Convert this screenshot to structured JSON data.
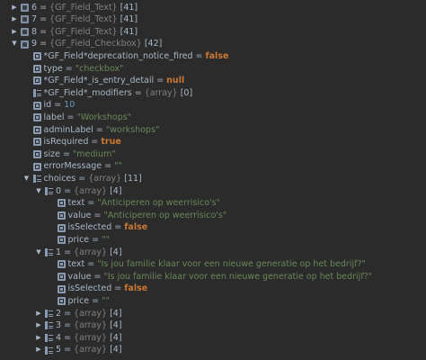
{
  "rows": [
    {
      "name": "6",
      "eq": " = ",
      "type": "{GF_Field_Text}",
      "count": " [41]",
      "value": "",
      "value_kind": "",
      "expanded": false,
      "icon": "object-icon"
    },
    {
      "name": "7",
      "eq": " = ",
      "type": "{GF_Field_Text}",
      "count": " [41]",
      "value": "",
      "value_kind": "",
      "expanded": false,
      "icon": "object-icon"
    },
    {
      "name": "8",
      "eq": " = ",
      "type": "{GF_Field_Text}",
      "count": " [41]",
      "value": "",
      "value_kind": "",
      "expanded": false,
      "icon": "object-icon"
    },
    {
      "name": "9",
      "eq": " = ",
      "type": "{GF_Field_Checkbox}",
      "count": " [42]",
      "value": "",
      "value_kind": "",
      "expanded": true,
      "icon": "object-icon"
    },
    {
      "name": "*GF_Field*deprecation_notice_fired",
      "eq": " = ",
      "type": "",
      "count": "",
      "value": "false",
      "value_kind": "kw",
      "icon": "field-icon"
    },
    {
      "name": "type",
      "eq": " = ",
      "type": "",
      "count": "",
      "value": "\"checkbox\"",
      "value_kind": "str",
      "icon": "field-icon"
    },
    {
      "name": "*GF_Field*_is_entry_detail",
      "eq": " = ",
      "type": "",
      "count": "",
      "value": "null",
      "value_kind": "kw",
      "icon": "field-icon"
    },
    {
      "name": "*GF_Field*_modifiers",
      "eq": " = ",
      "type": "{array}",
      "count": " [0]",
      "value": "",
      "value_kind": "",
      "icon": "array-icon"
    },
    {
      "name": "id",
      "eq": " = ",
      "type": "",
      "count": "",
      "value": "10",
      "value_kind": "num",
      "icon": "field-icon"
    },
    {
      "name": "label",
      "eq": " = ",
      "type": "",
      "count": "",
      "value": "\"Workshops\"",
      "value_kind": "str",
      "icon": "field-icon"
    },
    {
      "name": "adminLabel",
      "eq": " = ",
      "type": "",
      "count": "",
      "value": "\"workshops\"",
      "value_kind": "str",
      "icon": "field-icon"
    },
    {
      "name": "isRequired",
      "eq": " = ",
      "type": "",
      "count": "",
      "value": "true",
      "value_kind": "kw",
      "icon": "field-icon"
    },
    {
      "name": "size",
      "eq": " = ",
      "type": "",
      "count": "",
      "value": "\"medium\"",
      "value_kind": "str",
      "icon": "field-icon"
    },
    {
      "name": "errorMessage",
      "eq": " = ",
      "type": "",
      "count": "",
      "value": "\"\"",
      "value_kind": "str",
      "icon": "field-icon"
    },
    {
      "name": "choices",
      "eq": " = ",
      "type": "{array}",
      "count": " [11]",
      "value": "",
      "value_kind": "",
      "expanded": true,
      "icon": "array-icon"
    },
    {
      "name": "0",
      "eq": " = ",
      "type": "{array}",
      "count": " [4]",
      "value": "",
      "value_kind": "",
      "expanded": true,
      "icon": "array-icon"
    },
    {
      "name": "text",
      "eq": " = ",
      "type": "",
      "count": "",
      "value": "\"Anticiperen op weerrisico's\"",
      "value_kind": "str",
      "icon": "field-icon"
    },
    {
      "name": "value",
      "eq": " = ",
      "type": "",
      "count": "",
      "value": "\"Anticiperen op weerrisico's\"",
      "value_kind": "str",
      "icon": "field-icon"
    },
    {
      "name": "isSelected",
      "eq": " = ",
      "type": "",
      "count": "",
      "value": "false",
      "value_kind": "kw",
      "icon": "field-icon"
    },
    {
      "name": "price",
      "eq": " = ",
      "type": "",
      "count": "",
      "value": "\"\"",
      "value_kind": "str",
      "icon": "field-icon"
    },
    {
      "name": "1",
      "eq": " = ",
      "type": "{array}",
      "count": " [4]",
      "value": "",
      "value_kind": "",
      "expanded": true,
      "icon": "array-icon"
    },
    {
      "name": "text",
      "eq": " = ",
      "type": "",
      "count": "",
      "value": "\"Is jou familie klaar voor een nieuwe generatie op het bedrijf?\"",
      "value_kind": "str",
      "icon": "field-icon"
    },
    {
      "name": "value",
      "eq": " = ",
      "type": "",
      "count": "",
      "value": "\"Is jou familie klaar voor een nieuwe generatie op het bedrijf?\"",
      "value_kind": "str",
      "icon": "field-icon"
    },
    {
      "name": "isSelected",
      "eq": " = ",
      "type": "",
      "count": "",
      "value": "false",
      "value_kind": "kw",
      "icon": "field-icon"
    },
    {
      "name": "price",
      "eq": " = ",
      "type": "",
      "count": "",
      "value": "\"\"",
      "value_kind": "str",
      "icon": "field-icon"
    },
    {
      "name": "2",
      "eq": " = ",
      "type": "{array}",
      "count": " [4]",
      "value": "",
      "value_kind": "",
      "expanded": false,
      "icon": "array-icon"
    },
    {
      "name": "3",
      "eq": " = ",
      "type": "{array}",
      "count": " [4]",
      "value": "",
      "value_kind": "",
      "expanded": false,
      "icon": "array-icon"
    },
    {
      "name": "4",
      "eq": " = ",
      "type": "{array}",
      "count": " [4]",
      "value": "",
      "value_kind": "",
      "expanded": false,
      "icon": "array-icon"
    },
    {
      "name": "5",
      "eq": " = ",
      "type": "{array}",
      "count": " [4]",
      "value": "",
      "value_kind": "",
      "expanded": false,
      "icon": "array-icon"
    }
  ]
}
